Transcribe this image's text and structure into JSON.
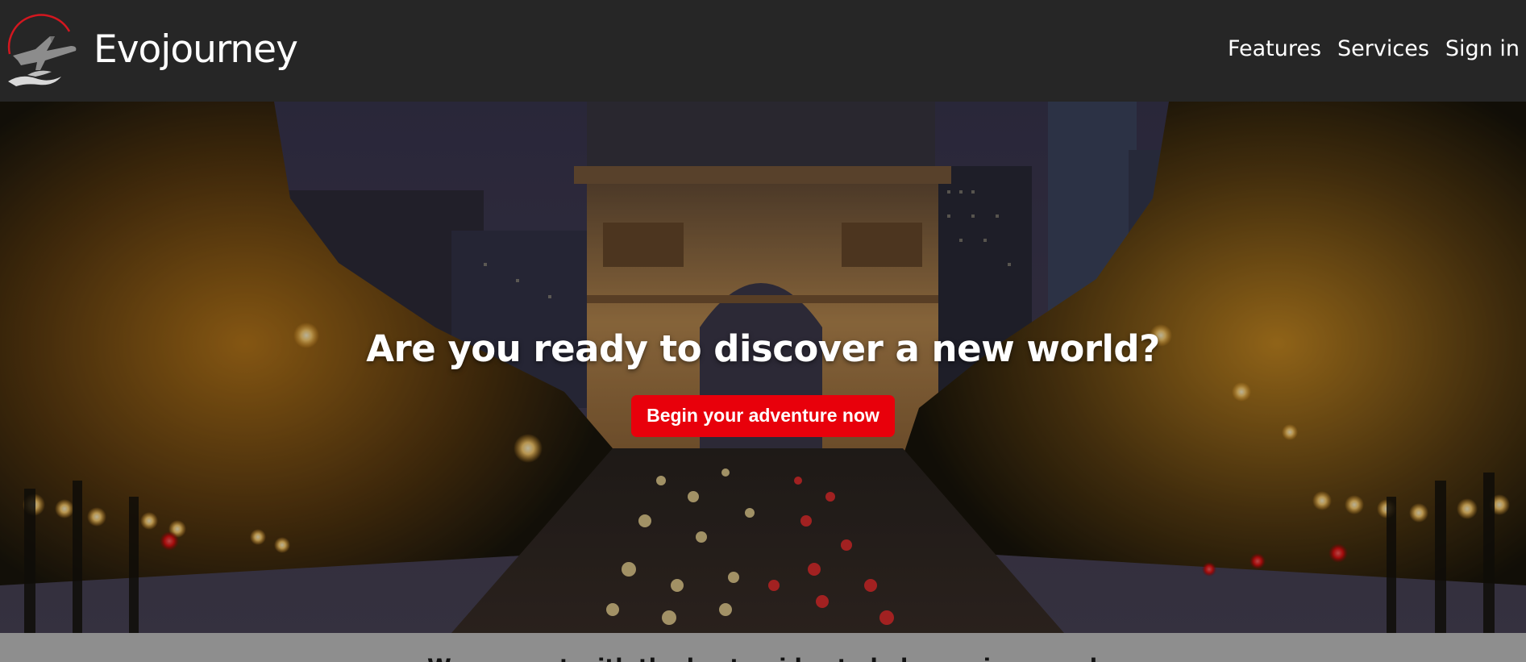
{
  "navbar": {
    "brand_name": "Evojourney",
    "logo_icon": "airplane-wave-logo",
    "links": [
      {
        "label": "Features"
      },
      {
        "label": "Services"
      },
      {
        "label": "Sign in"
      }
    ]
  },
  "hero": {
    "title": "Are you ready to discover a new world?",
    "cta_label": "Begin your adventure now",
    "background_image": "arc-de-triomphe-champs-elysees-night"
  },
  "intro": {
    "text": "We connect with the best guides to help you in a good way"
  },
  "colors": {
    "navbar_bg": "#262626",
    "cta_bg": "#e8000b",
    "strip_bg": "#8e8e8e",
    "text_light": "#ffffff"
  }
}
